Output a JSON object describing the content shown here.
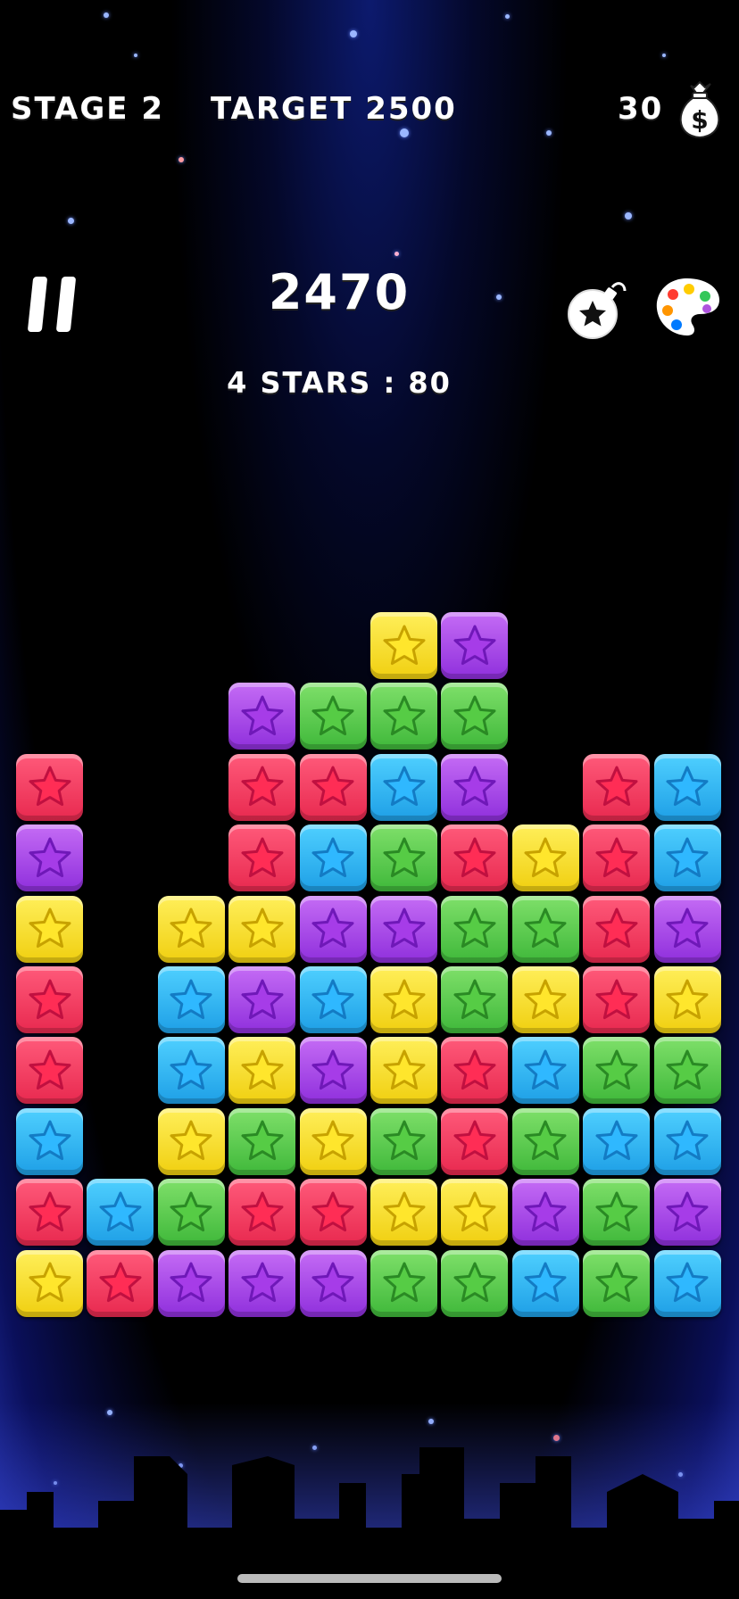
{
  "hud": {
    "stage": "STAGE 2",
    "target": "TARGET 2500",
    "coins": "30",
    "score": "2470",
    "stars_bonus": "4 STARS : 80"
  },
  "icons": {
    "pause": "pause-icon",
    "coin_bag": "money-bag-icon",
    "bomb": "bomb-star-icon",
    "palette": "palette-icon"
  },
  "colors": {
    "red": "#e8294f",
    "purple": "#8f2fdc",
    "yellow": "#f0cf10",
    "blue": "#1e9fe6",
    "green": "#3fb83a"
  },
  "board": {
    "columns": 10,
    "rows": 10,
    "grid": [
      [
        null,
        null,
        null,
        null,
        null,
        "yellow",
        "purple",
        null,
        null,
        null
      ],
      [
        null,
        null,
        null,
        "purple",
        "green",
        "green",
        "green",
        null,
        null,
        null
      ],
      [
        "red",
        null,
        null,
        "red",
        "red",
        "blue",
        "purple",
        null,
        "red",
        "blue"
      ],
      [
        "purple",
        null,
        null,
        "red",
        "blue",
        "green",
        "red",
        "yellow",
        "red",
        "blue"
      ],
      [
        "yellow",
        null,
        "yellow",
        "yellow",
        "purple",
        "purple",
        "green",
        "green",
        "red",
        "purple"
      ],
      [
        "red",
        null,
        "blue",
        "purple",
        "blue",
        "yellow",
        "green",
        "yellow",
        "red",
        "yellow"
      ],
      [
        "red",
        null,
        "blue",
        "yellow",
        "purple",
        "yellow",
        "red",
        "blue",
        "green",
        "green"
      ],
      [
        "blue",
        null,
        "yellow",
        "green",
        "yellow",
        "green",
        "red",
        "green",
        "blue",
        "blue"
      ],
      [
        "red",
        "blue",
        "green",
        "red",
        "red",
        "yellow",
        "yellow",
        "purple",
        "green",
        "purple"
      ],
      [
        "yellow",
        "red",
        "purple",
        "purple",
        "purple",
        "green",
        "green",
        "blue",
        "green",
        "blue"
      ]
    ]
  }
}
